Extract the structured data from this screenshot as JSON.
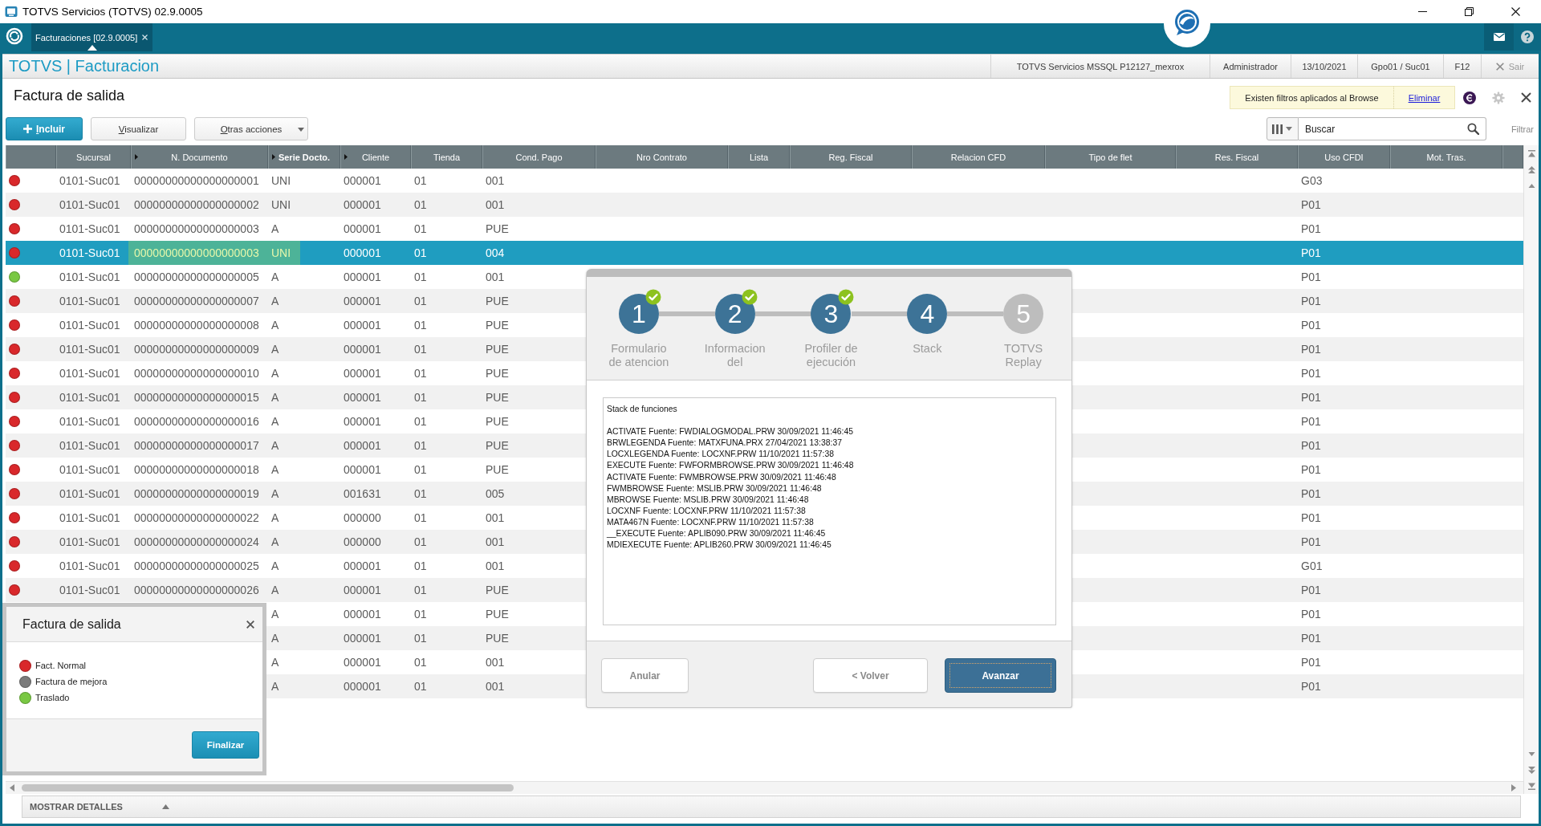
{
  "window": {
    "title": "TOTVS Servicios (TOTVS) 02.9.0005"
  },
  "tabs": [
    {
      "label": "Facturaciones [02.9.0005]",
      "selected": true
    }
  ],
  "app_header": {
    "title": "TOTVS | Facturacion",
    "info": [
      "TOTVS Servicios MSSQL P12127_mexrox",
      "Administrador",
      "13/10/2021",
      "Gpo01 / Suc01",
      "F12"
    ],
    "exit": "Sair"
  },
  "page": {
    "title": "Factura de salida",
    "filter_notice": {
      "text": "Existen filtros aplicados al Browse",
      "action": "Eliminar"
    }
  },
  "toolbar": {
    "buttons": [
      {
        "label": "Incluir",
        "kind": "primary"
      },
      {
        "label": "Visualizar",
        "kind": "plain"
      },
      {
        "label": "Otras acciones",
        "kind": "menu"
      }
    ],
    "search": {
      "placeholder": "Buscar"
    },
    "filter": "Filtrar"
  },
  "table": {
    "columns": [
      {
        "label": "Sucursal",
        "marked": false,
        "sorted": false
      },
      {
        "label": "N. Documento",
        "marked": true,
        "sorted": false
      },
      {
        "label": "Serie Docto.",
        "marked": true,
        "sorted": true
      },
      {
        "label": "Cliente",
        "marked": true,
        "sorted": false
      },
      {
        "label": "Tienda",
        "marked": false,
        "sorted": false
      },
      {
        "label": "Cond. Pago",
        "marked": false,
        "sorted": false
      },
      {
        "label": "Nro Contrato",
        "marked": false,
        "sorted": false
      },
      {
        "label": "Lista",
        "marked": false,
        "sorted": false
      },
      {
        "label": "Reg. Fiscal",
        "marked": false,
        "sorted": false
      },
      {
        "label": "Relacion CFD",
        "marked": false,
        "sorted": false
      },
      {
        "label": "Tipo de flet",
        "marked": false,
        "sorted": false
      },
      {
        "label": "Res. Fiscal",
        "marked": false,
        "sorted": false
      },
      {
        "label": "Uso CFDI",
        "marked": false,
        "sorted": false
      },
      {
        "label": "Mot. Tras.",
        "marked": false,
        "sorted": false
      }
    ],
    "rows": [
      {
        "color": "#d9282b",
        "selected": false,
        "focused": false,
        "cells": [
          "0101-Suc01",
          "00000000000000000001",
          "UNI",
          "000001",
          "01",
          "001",
          null,
          null,
          null,
          null,
          null,
          null,
          "G03",
          null
        ]
      },
      {
        "color": "#d9282b",
        "selected": false,
        "focused": false,
        "cells": [
          "0101-Suc01",
          "00000000000000000002",
          "UNI",
          "000001",
          "01",
          "001",
          null,
          null,
          null,
          null,
          null,
          null,
          "P01",
          null
        ]
      },
      {
        "color": "#d9282b",
        "selected": false,
        "focused": false,
        "cells": [
          "0101-Suc01",
          "00000000000000000003",
          "A",
          "000001",
          "01",
          "PUE",
          null,
          null,
          null,
          null,
          null,
          null,
          "P01",
          null
        ]
      },
      {
        "color": "#d9282b",
        "selected": true,
        "focused": true,
        "cells": [
          "0101-Suc01",
          "00000000000000000003",
          "UNI",
          "000001",
          "01",
          "004",
          null,
          null,
          null,
          null,
          null,
          null,
          "P01",
          null
        ]
      },
      {
        "color": "#79c843",
        "selected": false,
        "focused": false,
        "cells": [
          "0101-Suc01",
          "00000000000000000005",
          "A",
          "000001",
          "01",
          "001",
          null,
          null,
          null,
          null,
          null,
          null,
          "P01",
          null
        ]
      },
      {
        "color": "#d9282b",
        "selected": false,
        "focused": false,
        "cells": [
          "0101-Suc01",
          "00000000000000000007",
          "A",
          "000001",
          "01",
          "PUE",
          null,
          null,
          null,
          null,
          null,
          null,
          "P01",
          null
        ]
      },
      {
        "color": "#d9282b",
        "selected": false,
        "focused": false,
        "cells": [
          "0101-Suc01",
          "00000000000000000008",
          "A",
          "000001",
          "01",
          "PUE",
          null,
          null,
          null,
          null,
          null,
          null,
          "P01",
          null
        ]
      },
      {
        "color": "#d9282b",
        "selected": false,
        "focused": false,
        "cells": [
          "0101-Suc01",
          "00000000000000000009",
          "A",
          "000001",
          "01",
          "PUE",
          null,
          null,
          null,
          null,
          null,
          null,
          "P01",
          null
        ]
      },
      {
        "color": "#d9282b",
        "selected": false,
        "focused": false,
        "cells": [
          "0101-Suc01",
          "00000000000000000010",
          "A",
          "000001",
          "01",
          "PUE",
          null,
          null,
          null,
          null,
          null,
          null,
          "P01",
          null
        ]
      },
      {
        "color": "#d9282b",
        "selected": false,
        "focused": false,
        "cells": [
          "0101-Suc01",
          "00000000000000000015",
          "A",
          "000001",
          "01",
          "PUE",
          null,
          null,
          null,
          null,
          null,
          null,
          "P01",
          null
        ]
      },
      {
        "color": "#d9282b",
        "selected": false,
        "focused": false,
        "cells": [
          "0101-Suc01",
          "00000000000000000016",
          "A",
          "000001",
          "01",
          "PUE",
          null,
          null,
          null,
          null,
          null,
          null,
          "P01",
          null
        ]
      },
      {
        "color": "#d9282b",
        "selected": false,
        "focused": false,
        "cells": [
          "0101-Suc01",
          "00000000000000000017",
          "A",
          "000001",
          "01",
          "PUE",
          null,
          null,
          null,
          null,
          null,
          null,
          "P01",
          null
        ]
      },
      {
        "color": "#d9282b",
        "selected": false,
        "focused": false,
        "cells": [
          "0101-Suc01",
          "00000000000000000018",
          "A",
          "000001",
          "01",
          "PUE",
          null,
          null,
          null,
          null,
          null,
          null,
          "P01",
          null
        ]
      },
      {
        "color": "#d9282b",
        "selected": false,
        "focused": false,
        "cells": [
          "0101-Suc01",
          "00000000000000000019",
          "A",
          "001631",
          "01",
          "005",
          null,
          null,
          null,
          null,
          null,
          null,
          "P01",
          null
        ]
      },
      {
        "color": "#d9282b",
        "selected": false,
        "focused": false,
        "cells": [
          "0101-Suc01",
          "00000000000000000022",
          "A",
          "000000",
          "01",
          "001",
          null,
          null,
          null,
          null,
          null,
          null,
          "P01",
          null
        ]
      },
      {
        "color": "#d9282b",
        "selected": false,
        "focused": false,
        "cells": [
          "0101-Suc01",
          "00000000000000000024",
          "A",
          "000000",
          "01",
          "001",
          null,
          null,
          null,
          null,
          null,
          null,
          "P01",
          null
        ]
      },
      {
        "color": "#d9282b",
        "selected": false,
        "focused": false,
        "cells": [
          "0101-Suc01",
          "00000000000000000025",
          "A",
          "000001",
          "01",
          "001",
          null,
          null,
          null,
          null,
          null,
          null,
          "G01",
          null
        ]
      },
      {
        "color": "#d9282b",
        "selected": false,
        "focused": false,
        "cells": [
          "0101-Suc01",
          "00000000000000000026",
          "A",
          "000001",
          "01",
          "PUE",
          null,
          null,
          null,
          null,
          null,
          null,
          "P01",
          null
        ]
      },
      {
        "selected": false,
        "focused": false,
        "cells": [
          null,
          null,
          "A",
          "000001",
          "01",
          "PUE",
          null,
          null,
          null,
          null,
          null,
          null,
          "P01",
          null
        ]
      },
      {
        "selected": false,
        "focused": false,
        "cells": [
          null,
          null,
          "A",
          "000001",
          "01",
          "PUE",
          null,
          null,
          null,
          null,
          null,
          null,
          "P01",
          null
        ]
      },
      {
        "selected": false,
        "focused": false,
        "cells": [
          null,
          null,
          "A",
          "000001",
          "01",
          "001",
          null,
          null,
          null,
          null,
          null,
          null,
          "P01",
          null
        ]
      },
      {
        "selected": false,
        "focused": false,
        "cells": [
          null,
          null,
          "A",
          "000001",
          "01",
          "001",
          null,
          null,
          null,
          null,
          null,
          null,
          "P01",
          null
        ]
      }
    ]
  },
  "details_bar": {
    "label": "MOSTRAR DETALLES",
    "expanded": false
  },
  "wizard": {
    "steps": [
      {
        "number": "1",
        "label": "Formulario de atencion",
        "completed": true,
        "disabled": false
      },
      {
        "number": "2",
        "label": "Informacion del",
        "completed": true,
        "disabled": false
      },
      {
        "number": "3",
        "label": "Profiler de ejecución",
        "completed": true,
        "disabled": false
      },
      {
        "number": "4",
        "label": "Stack",
        "completed": false,
        "disabled": false
      },
      {
        "number": "5",
        "label": "TOTVS Replay",
        "completed": false,
        "disabled": true
      }
    ],
    "content": {
      "heading": "Stack de funciones",
      "lines": [
        "ACTIVATE Fuente: FWDIALOGMODAL.PRW 30/09/2021 11:46:45",
        "BRWLEGENDA Fuente: MATXFUNA.PRX 27/04/2021 13:38:37",
        "LOCXLEGENDA Fuente: LOCXNF.PRW 11/10/2021 11:57:38",
        "EXECUTE Fuente: FWFORMBROWSE.PRW 30/09/2021 11:46:48",
        "ACTIVATE Fuente: FWMBROWSE.PRW 30/09/2021 11:46:48",
        "FWMBROWSE Fuente: MSLIB.PRW 30/09/2021 11:46:48",
        "MBROWSE Fuente: MSLIB.PRW 30/09/2021 11:46:48",
        "LOCXNF Fuente: LOCXNF.PRW 11/10/2021 11:57:38",
        "MATA467N Fuente: LOCXNF.PRW 11/10/2021 11:57:38",
        "__EXECUTE Fuente: APLIB090.PRW 30/09/2021 11:46:45",
        "MDIEXECUTE Fuente: APLIB260.PRW 30/09/2021 11:46:45"
      ]
    },
    "buttons": [
      {
        "label": "Anular",
        "kind": "secondary"
      },
      {
        "label": "< Volver",
        "kind": "secondary"
      },
      {
        "label": "Avanzar",
        "kind": "primary"
      }
    ]
  },
  "legend": {
    "title": "Factura de salida",
    "items": [
      {
        "label": "Fact. Normal",
        "color": "#d9282b"
      },
      {
        "label": "Factura de mejora",
        "color": "#7b7b7b"
      },
      {
        "label": "Traslado",
        "color": "#79c843"
      }
    ],
    "button": "Finalizar"
  }
}
